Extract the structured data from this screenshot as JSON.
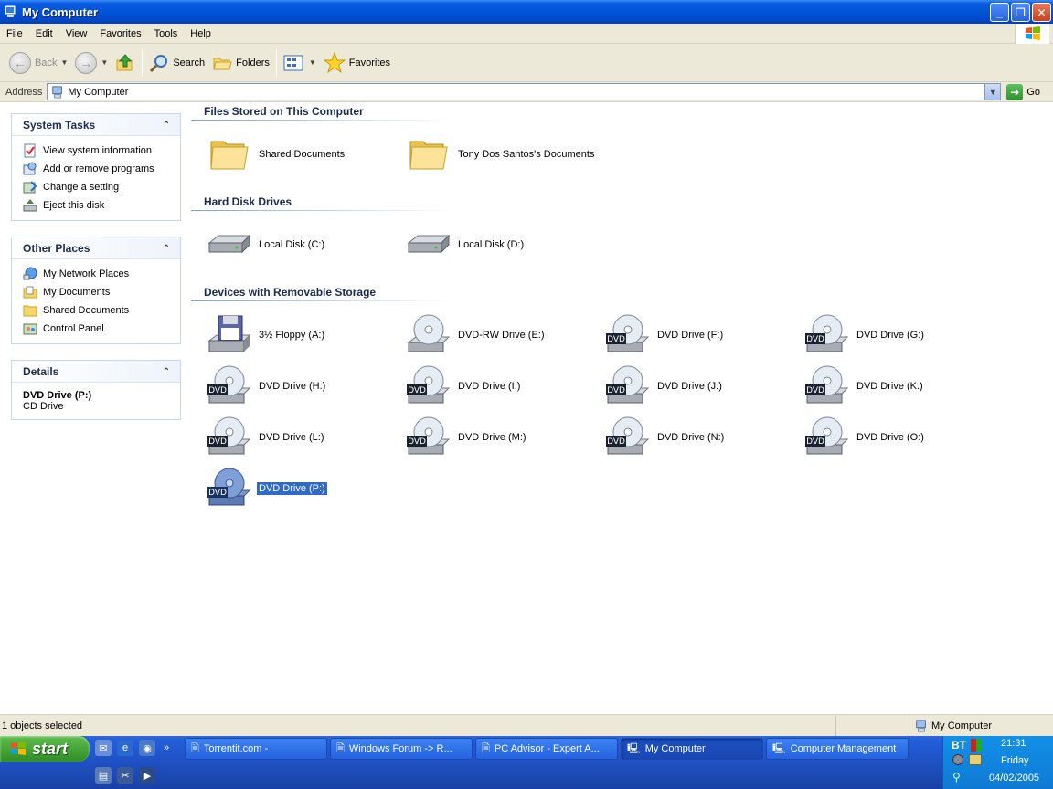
{
  "window": {
    "title": "My Computer"
  },
  "menu": [
    "File",
    "Edit",
    "View",
    "Favorites",
    "Tools",
    "Help"
  ],
  "toolbar": {
    "back": "Back",
    "search": "Search",
    "folders": "Folders",
    "favorites": "Favorites"
  },
  "address": {
    "label": "Address",
    "value": "My Computer",
    "go": "Go"
  },
  "tasks": {
    "system": {
      "title": "System Tasks",
      "items": [
        "View system information",
        "Add or remove programs",
        "Change a setting",
        "Eject this disk"
      ]
    },
    "other": {
      "title": "Other Places",
      "items": [
        "My Network Places",
        "My Documents",
        "Shared Documents",
        "Control Panel"
      ]
    },
    "details": {
      "title": "Details",
      "name": "DVD Drive (P:)",
      "type": "CD Drive"
    }
  },
  "groups": {
    "files": {
      "title": "Files Stored on This Computer",
      "items": [
        "Shared Documents",
        "Tony Dos Santos's Documents"
      ]
    },
    "hdd": {
      "title": "Hard Disk Drives",
      "items": [
        "Local Disk (C:)",
        "Local Disk (D:)"
      ]
    },
    "removable": {
      "title": "Devices with Removable Storage",
      "items": [
        "3½ Floppy (A:)",
        "DVD-RW Drive (E:)",
        "DVD Drive (F:)",
        "DVD Drive (G:)",
        "DVD Drive (H:)",
        "DVD Drive (I:)",
        "DVD Drive (J:)",
        "DVD Drive (K:)",
        "DVD Drive (L:)",
        "DVD Drive (M:)",
        "DVD Drive (N:)",
        "DVD Drive (O:)",
        "DVD Drive (P:)"
      ],
      "selected": "DVD Drive (P:)"
    }
  },
  "dvd_badge": "DVD",
  "status": {
    "left": "1 objects selected",
    "right": "My Computer"
  },
  "taskbar": {
    "start": "start",
    "tasks": [
      "Torrentit.com -",
      "Windows Forum -> R...",
      "PC Advisor - Expert A...",
      "My Computer",
      "Computer Management"
    ],
    "active": "My Computer",
    "tray": {
      "isp": "BT",
      "time": "21:31",
      "day": "Friday",
      "date": "04/02/2005"
    }
  }
}
